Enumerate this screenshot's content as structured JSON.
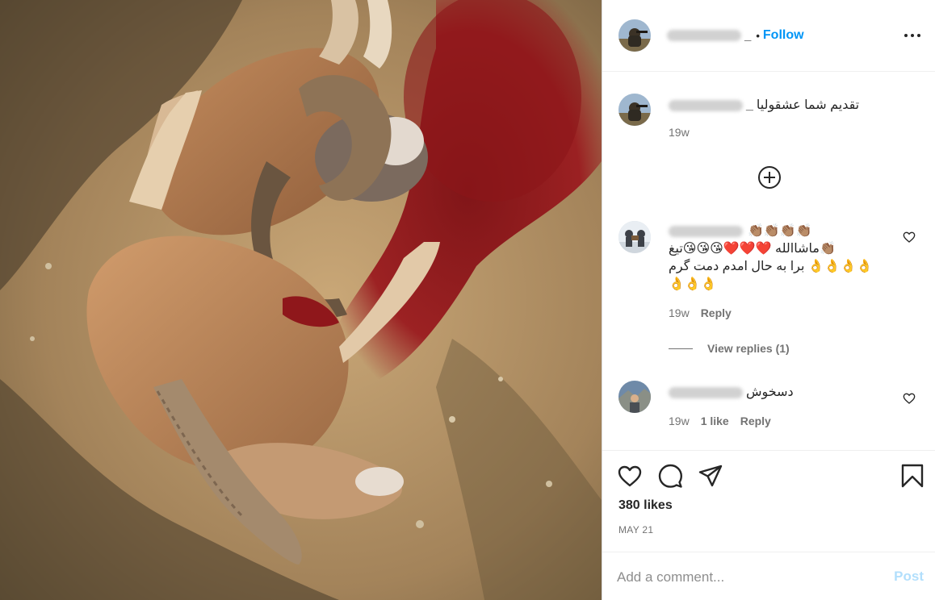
{
  "post": {
    "username_trailing": "_",
    "separator": "•",
    "follow_label": "Follow",
    "more_icon": "more-horizontal-icon"
  },
  "caption": {
    "username_trailing": "_",
    "text": "تقدیم شما عشقولیا",
    "time": "19w"
  },
  "load_more_icon": "add-circle-icon",
  "comments": [
    {
      "emoji_line": "👏🏽👏🏽👏🏽👏🏽",
      "line1": "ماشاالله ❤️❤️❤️😘😘😘تیغ👏🏽",
      "line2": "برا به حال امدم دمت گرم 👌👌👌👌",
      "line3": "👌👌👌",
      "time": "19w",
      "reply_label": "Reply",
      "view_replies": "View replies (1)"
    },
    {
      "text": "دسخوش",
      "time": "19w",
      "likes": "1 like",
      "reply_label": "Reply"
    }
  ],
  "actions": {
    "like_icon": "heart-icon",
    "comment_icon": "comment-icon",
    "share_icon": "share-icon",
    "save_icon": "bookmark-icon"
  },
  "likes_text": "380 likes",
  "date_text": "MAY 21",
  "add_comment": {
    "placeholder": "Add a comment...",
    "post_label": "Post"
  },
  "colors": {
    "accent": "#0095f6",
    "post_disabled": "#b2dffc",
    "muted": "#737373",
    "text": "#262626",
    "border": "#dbdbdb"
  }
}
